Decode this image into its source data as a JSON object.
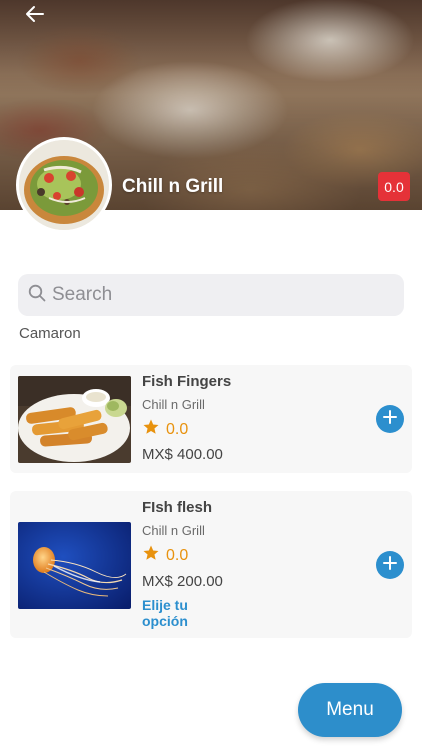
{
  "header": {
    "restaurant_name": "Chill n Grill",
    "cart_total": "0.0"
  },
  "search": {
    "placeholder": "Search",
    "value": ""
  },
  "category": {
    "label": "Camaron"
  },
  "products": [
    {
      "title": "Fish Fingers",
      "vendor": "Chill n Grill",
      "rating": "0.0",
      "price": "MX$ 400.00",
      "image_icon": "fish-fingers-photo"
    },
    {
      "title": "FIsh flesh",
      "vendor": "Chill n Grill",
      "rating": "0.0",
      "price": "MX$ 200.00",
      "options_label": "Elije tu opción",
      "image_icon": "jellyfish-photo"
    }
  ],
  "footer": {
    "menu_label": "Menu"
  },
  "colors": {
    "accent": "#2c8fce",
    "badge_red": "#e53238",
    "rating_orange": "#e8920e"
  }
}
